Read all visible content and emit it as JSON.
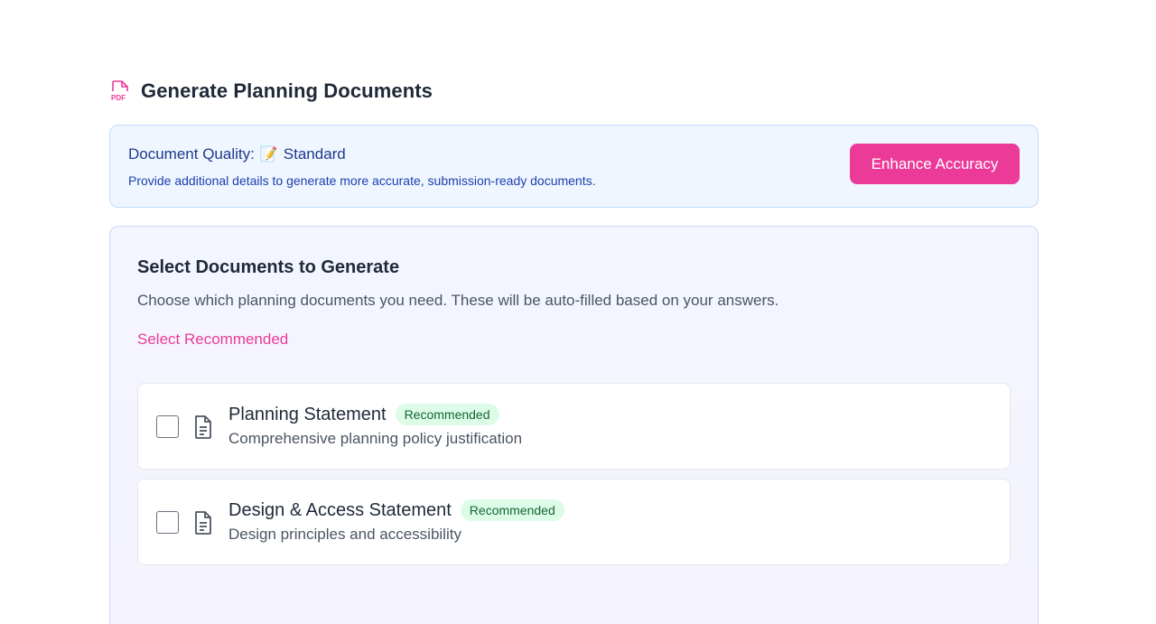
{
  "header": {
    "title": "Generate Planning Documents",
    "icon": "pdf-icon",
    "icon_label": "PDF",
    "accent_color": "#ec3a99"
  },
  "quality": {
    "label": "Document Quality:",
    "pencil_icon": "📝",
    "level": "Standard",
    "description": "Provide additional details to generate more accurate, submission-ready documents.",
    "button_label": "Enhance Accuracy"
  },
  "selection": {
    "title": "Select Documents to Generate",
    "description": "Choose which planning documents you need. These will be auto-filled based on your answers.",
    "select_recommended_label": "Select Recommended",
    "documents": [
      {
        "name": "Planning Statement",
        "badge": "Recommended",
        "description": "Comprehensive planning policy justification",
        "checked": false,
        "icon": "document-icon"
      },
      {
        "name": "Design & Access Statement",
        "badge": "Recommended",
        "description": "Design principles and accessibility",
        "checked": false,
        "icon": "document-icon"
      }
    ]
  }
}
